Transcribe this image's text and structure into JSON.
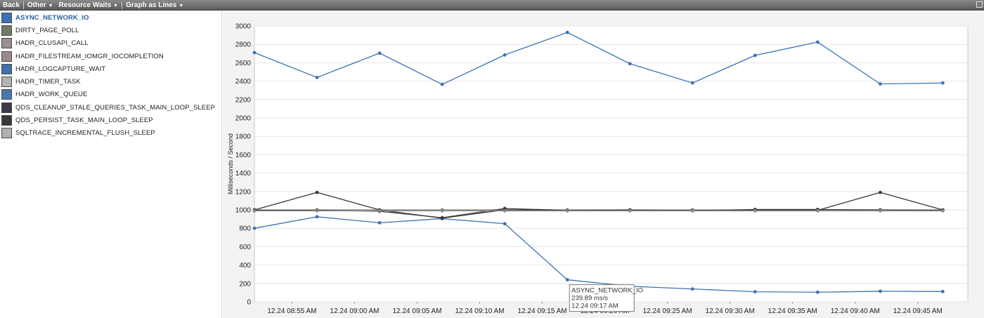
{
  "toolbar": {
    "back_label": "Back",
    "other_label": "Other",
    "resource_waits_label": "Resource Waits",
    "graph_mode_label": "Graph as Lines"
  },
  "legend": {
    "items": [
      {
        "label": "ASYNC_NETWORK_IO",
        "color": "#3b72b4",
        "selected": true
      },
      {
        "label": "DIRTY_PAGE_POLL",
        "color": "#6e7b66",
        "selected": false
      },
      {
        "label": "HADR_CLUSAPI_CALL",
        "color": "#9a8f8f",
        "selected": false
      },
      {
        "label": "HADR_FILESTREAM_IOMGR_IOCOMPLETION",
        "color": "#9c8a8a",
        "selected": false
      },
      {
        "label": "HADR_LOGCAPTURE_WAIT",
        "color": "#4071ad",
        "selected": false
      },
      {
        "label": "HADR_TIMER_TASK",
        "color": "#b3b3b3",
        "selected": false
      },
      {
        "label": "HADR_WORK_QUEUE",
        "color": "#4a78b0",
        "selected": false
      },
      {
        "label": "QDS_CLEANUP_STALE_QUERIES_TASK_MAIN_LOOP_SLEEP",
        "color": "#3a3a48",
        "selected": false
      },
      {
        "label": "QDS_PERSIST_TASK_MAIN_LOOP_SLEEP",
        "color": "#3b3836",
        "selected": false
      },
      {
        "label": "SQLTRACE_INCREMENTAL_FLUSH_SLEEP",
        "color": "#b0b0b0",
        "selected": false
      }
    ]
  },
  "chart_data": {
    "type": "line",
    "title": "",
    "xlabel": "",
    "ylabel": "Milliseconds / Second",
    "ylim": [
      0,
      3000
    ],
    "yticks": [
      0,
      200,
      400,
      600,
      800,
      1000,
      1200,
      1400,
      1600,
      1800,
      2000,
      2200,
      2400,
      2600,
      2800,
      3000
    ],
    "xlim": [
      "08:52",
      "09:49"
    ],
    "xticks": [
      "12.24 08:55 AM",
      "12.24 09:00 AM",
      "12.24 09:05 AM",
      "12.24 09:10 AM",
      "12.24 09:15 AM",
      "12.24 09:20 AM",
      "12.24 09:25 AM",
      "12.24 09:30 AM",
      "12.24 09:35 AM",
      "12.24 09:40 AM",
      "12.24 09:45 AM"
    ],
    "x": [
      "08:52",
      "08:57",
      "09:02",
      "09:07",
      "09:12",
      "09:17",
      "09:22",
      "09:27",
      "09:32",
      "09:37",
      "09:42",
      "09:47"
    ],
    "grid": true,
    "legend": "left panel",
    "series": [
      {
        "name": "ASYNC_NETWORK_IO",
        "color": "#3b72b4",
        "values": [
          2710,
          2440,
          2705,
          2365,
          2685,
          2930,
          2590,
          2380,
          2680,
          2825,
          2370,
          2380
        ]
      },
      {
        "name": "DIRTY_PAGE_POLL",
        "color": "#6e7b66",
        "values": [
          1000,
          1000,
          1000,
          1000,
          1000,
          1000,
          1000,
          1000,
          1000,
          1000,
          1000,
          1000
        ]
      },
      {
        "name": "HADR_LOGCAPTURE_WAIT",
        "color": "#4071ad",
        "values": [
          800,
          925,
          860,
          905,
          850,
          239.89,
          170,
          140,
          110,
          105,
          115,
          112
        ]
      },
      {
        "name": "QDS_CLEANUP_STALE_QUERIES_TASK_MAIN_LOOP_SLEEP",
        "color": "#3a3a48",
        "values": [
          1000,
          1190,
          1000,
          910,
          1000,
          995,
          995,
          995,
          995,
          995,
          1190,
          1000
        ]
      },
      {
        "name": "QDS_PERSIST_TASK_MAIN_LOOP_SLEEP",
        "color": "#3b3836",
        "values": [
          995,
          995,
          985,
          915,
          1015,
          995,
          1000,
          990,
          1005,
          1005,
          1000,
          995
        ]
      },
      {
        "name": "SQLTRACE_INCREMENTAL_FLUSH_SLEEP",
        "color": "#8a8a8a",
        "values": [
          990,
          990,
          990,
          990,
          990,
          990,
          990,
          990,
          990,
          990,
          990,
          990
        ]
      }
    ],
    "tooltip": {
      "series": "ASYNC_NETWORK_IO",
      "value_text": "239.89 ms/s",
      "time_text": "12.24 09:17 AM",
      "point_index": 5,
      "target_series_index": 2
    }
  }
}
